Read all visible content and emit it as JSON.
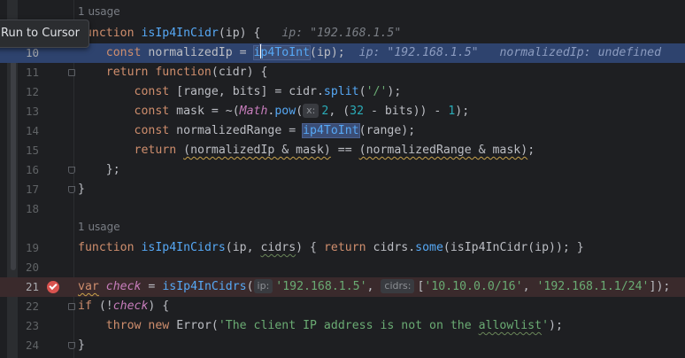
{
  "tooltip": {
    "text": "Run to Cursor"
  },
  "usages": {
    "top": "1 usage",
    "middle": "1 usage"
  },
  "line_numbers": [
    "10",
    "11",
    "12",
    "13",
    "14",
    "15",
    "16",
    "17",
    "18",
    "19",
    "20",
    "21",
    "22",
    "23",
    "24"
  ],
  "line9": {
    "kw_function": "function",
    "name": "isIp4InCidr",
    "open": "(",
    "param": "ip",
    "close": ") {",
    "hint": "ip: \"192.168.1.5\""
  },
  "line10": {
    "indent": "    ",
    "kw_const": "const",
    "var": " normalizedIp = ",
    "call": "p4ToInt",
    "call_first": "i",
    "args": "(ip);",
    "hint1": "ip: \"192.168.1.5\"",
    "hint2": "normalizedIp: undefined"
  },
  "line11": {
    "indent": "    ",
    "kw_return": "return",
    "kw_function": " function",
    "rest": "(cidr) {"
  },
  "line12": {
    "indent": "        ",
    "kw_const": "const",
    "rest1": " [range, bits] = cidr.",
    "fn": "split",
    "open": "(",
    "str": "'/'",
    "close": ");"
  },
  "line13": {
    "indent": "        ",
    "kw_const": "const",
    "rest1": " mask = ~(",
    "cls": "Math",
    "dot": ".",
    "fn": "pow",
    "open": "(",
    "inlay": "x:",
    "num1": "2",
    "mid": ", (",
    "num2": "32",
    "rest2": " - bits)) - ",
    "num3": "1",
    "close": ");"
  },
  "line14": {
    "indent": "        ",
    "kw_const": "const",
    "rest1": " normalizedRange = ",
    "fn": "ip4ToInt",
    "rest2": "(range);"
  },
  "line15": {
    "indent": "        ",
    "kw_return": "return",
    "sp": " ",
    "expr1": "(normalizedIp & mask)",
    "op": " == ",
    "expr2": "(normalizedRange & mask)",
    "semi": ";"
  },
  "line16": {
    "indent": "    ",
    "text": "};"
  },
  "line17": {
    "text": "}"
  },
  "line19": {
    "kw_function": "function",
    "sp": " ",
    "name": "isIp4InCidrs",
    "open": "(ip, ",
    "param2": "cidrs",
    "close": ") { ",
    "kw_return": "return",
    "rest1": " cidrs.",
    "fn": "some",
    "rest2": "(isIp4InCidr(ip)); }"
  },
  "line21": {
    "kw_var": "var",
    "sp": " ",
    "name": "check",
    "eq": " = ",
    "fn": "isIp4InCidrs",
    "open": "(",
    "inlay1": "ip:",
    "str1": "'192.168.1.5'",
    "comma": ", ",
    "inlay2": "cidrs:",
    "open2": "[",
    "str2": "'10.10.0.0/16'",
    "comma2": ", ",
    "str3": "'192.168.1.1/24'",
    "close": "]);"
  },
  "line22": {
    "kw_if": "if",
    "rest1": " (!",
    "var": "check",
    "rest2": ") {"
  },
  "line23": {
    "indent": "    ",
    "kw_throw": "throw",
    "kw_new": " new",
    "sp": " ",
    "cls": "Error",
    "open": "(",
    "str1": "'The client IP address is not on the ",
    "str2": "allowlist",
    "str3": "'",
    "close": ");"
  },
  "line24": {
    "text": "}"
  },
  "colors": {
    "background": "#1e1f22",
    "keyword": "#cf8e6d",
    "function": "#56a8f5",
    "string": "#6aab73",
    "number": "#2aacb8",
    "execution_line": "#2e436e",
    "breakpoint": "#d9534f"
  }
}
